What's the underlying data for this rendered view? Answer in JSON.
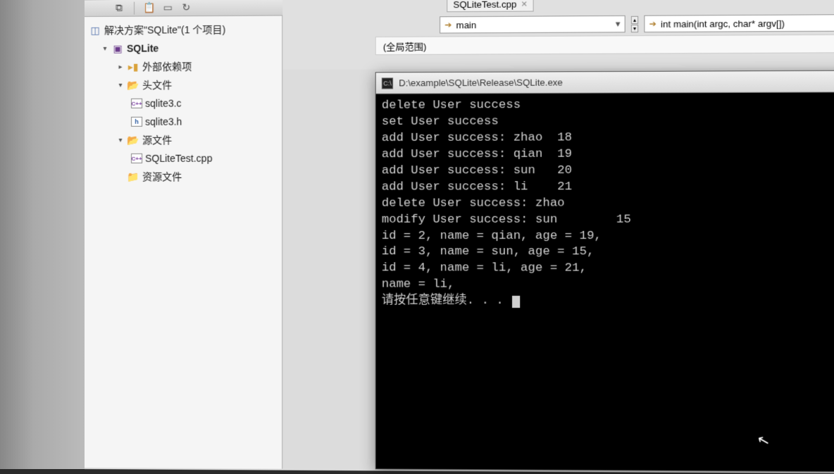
{
  "solution": {
    "root_label": "解决方案\"SQLite\"(1 个项目)",
    "project": "SQLite",
    "nodes": {
      "external": "外部依赖项",
      "headers": "头文件",
      "header_files": [
        "sqlite3.c",
        "sqlite3.h"
      ],
      "sources": "源文件",
      "source_files": [
        "SQLiteTest.cpp"
      ],
      "resources": "资源文件"
    }
  },
  "editor": {
    "tab_filename": "SQLiteTest.cpp",
    "nav_scope": "main",
    "nav_function": "int main(int argc, char* argv[])",
    "scope_label": "(全局范围)"
  },
  "console": {
    "title": "D:\\example\\SQLite\\Release\\SQLite.exe",
    "lines": [
      "delete User success",
      "set User success",
      "add User success: zhao  18",
      "add User success: qian  19",
      "add User success: sun   20",
      "add User success: li    21",
      "delete User success: zhao",
      "modify User success: sun        15",
      "id = 2, name = qian, age = 19,",
      "id = 3, name = sun, age = 15,",
      "id = 4, name = li, age = 21,",
      "name = li,",
      "请按任意键继续. . . "
    ]
  }
}
